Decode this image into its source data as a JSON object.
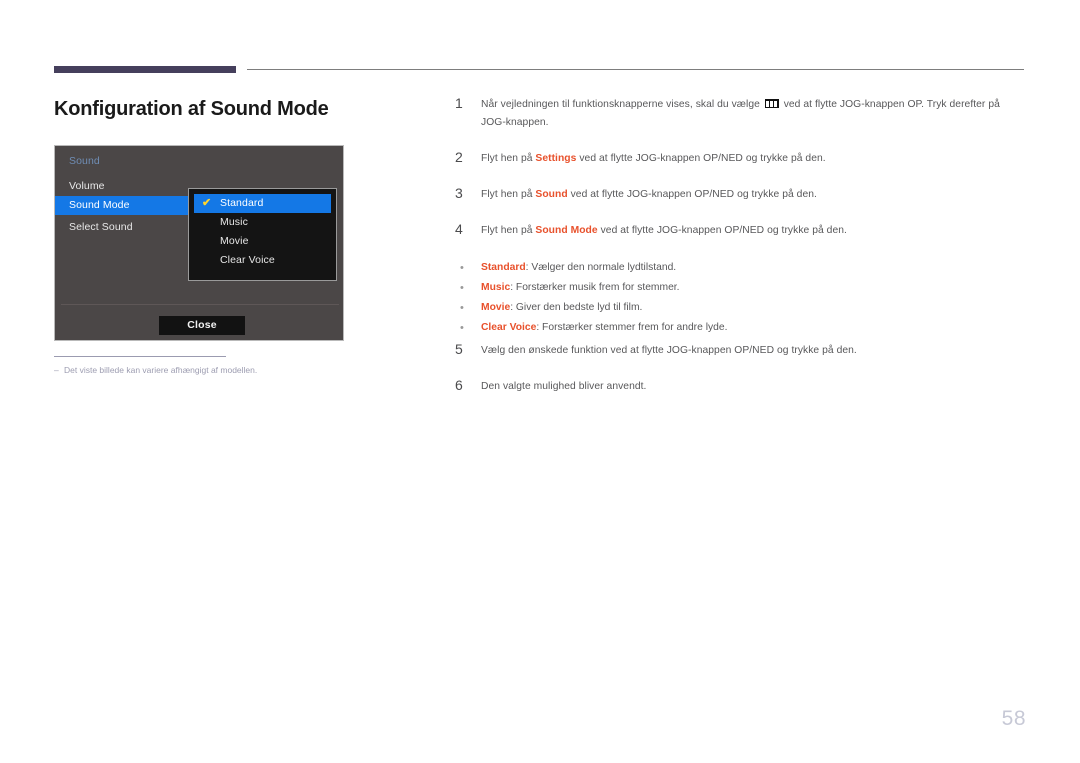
{
  "page": {
    "title": "Konfiguration af Sound Mode",
    "number": "58",
    "accent_bar_color": "#453f5c",
    "highlight_color": "#e8512c"
  },
  "osd": {
    "heading": "Sound",
    "rows": [
      {
        "label": "Volume",
        "selected": false
      },
      {
        "label": "Sound Mode",
        "selected": true
      },
      {
        "label": "Select Sound",
        "selected": false
      }
    ],
    "submenu": {
      "items": [
        {
          "label": "Standard",
          "selected": true,
          "check": "✔"
        },
        {
          "label": "Music",
          "selected": false,
          "check": ""
        },
        {
          "label": "Movie",
          "selected": false,
          "check": ""
        },
        {
          "label": "Clear Voice",
          "selected": false,
          "check": ""
        }
      ]
    },
    "close_label": "Close",
    "highlight_color": "#1478e6",
    "check_color": "#ffd52e"
  },
  "footnote": {
    "dash": "–",
    "text": "Det viste billede kan variere afhængigt af modellen."
  },
  "instructions": {
    "steps": [
      {
        "num": "1",
        "pre": "Når vejledningen til funktionsknapperne vises, skal du vælge ",
        "icon": "menu-glyph-icon",
        "post": " ved at flytte JOG-knappen OP. Tryk derefter på JOG-knappen."
      },
      {
        "num": "2",
        "pre": "Flyt hen på ",
        "hl": "Settings",
        "post": " ved at flytte JOG-knappen OP/NED og trykke på den."
      },
      {
        "num": "3",
        "pre": "Flyt hen på ",
        "hl": "Sound",
        "post": " ved at flytte JOG-knappen OP/NED og trykke på den."
      },
      {
        "num": "4",
        "pre": "Flyt hen på ",
        "hl": "Sound Mode",
        "post": " ved at flytte JOG-knappen OP/NED og trykke på den."
      }
    ],
    "bullets": [
      {
        "dot": "•",
        "hl": "Standard",
        "post": ": Vælger den normale lydtilstand."
      },
      {
        "dot": "•",
        "hl": "Music",
        "post": ": Forstærker musik frem for stemmer."
      },
      {
        "dot": "•",
        "hl": "Movie",
        "post": ": Giver den bedste lyd til film."
      },
      {
        "dot": "•",
        "hl": "Clear Voice",
        "post": ": Forstærker stemmer frem for andre lyde."
      }
    ],
    "steps_after": [
      {
        "num": "5",
        "pre": "Vælg den ønskede funktion ved at flytte JOG-knappen OP/NED og trykke på den.",
        "hl": "",
        "post": ""
      },
      {
        "num": "6",
        "pre": "Den valgte mulighed bliver anvendt.",
        "hl": "",
        "post": ""
      }
    ]
  }
}
